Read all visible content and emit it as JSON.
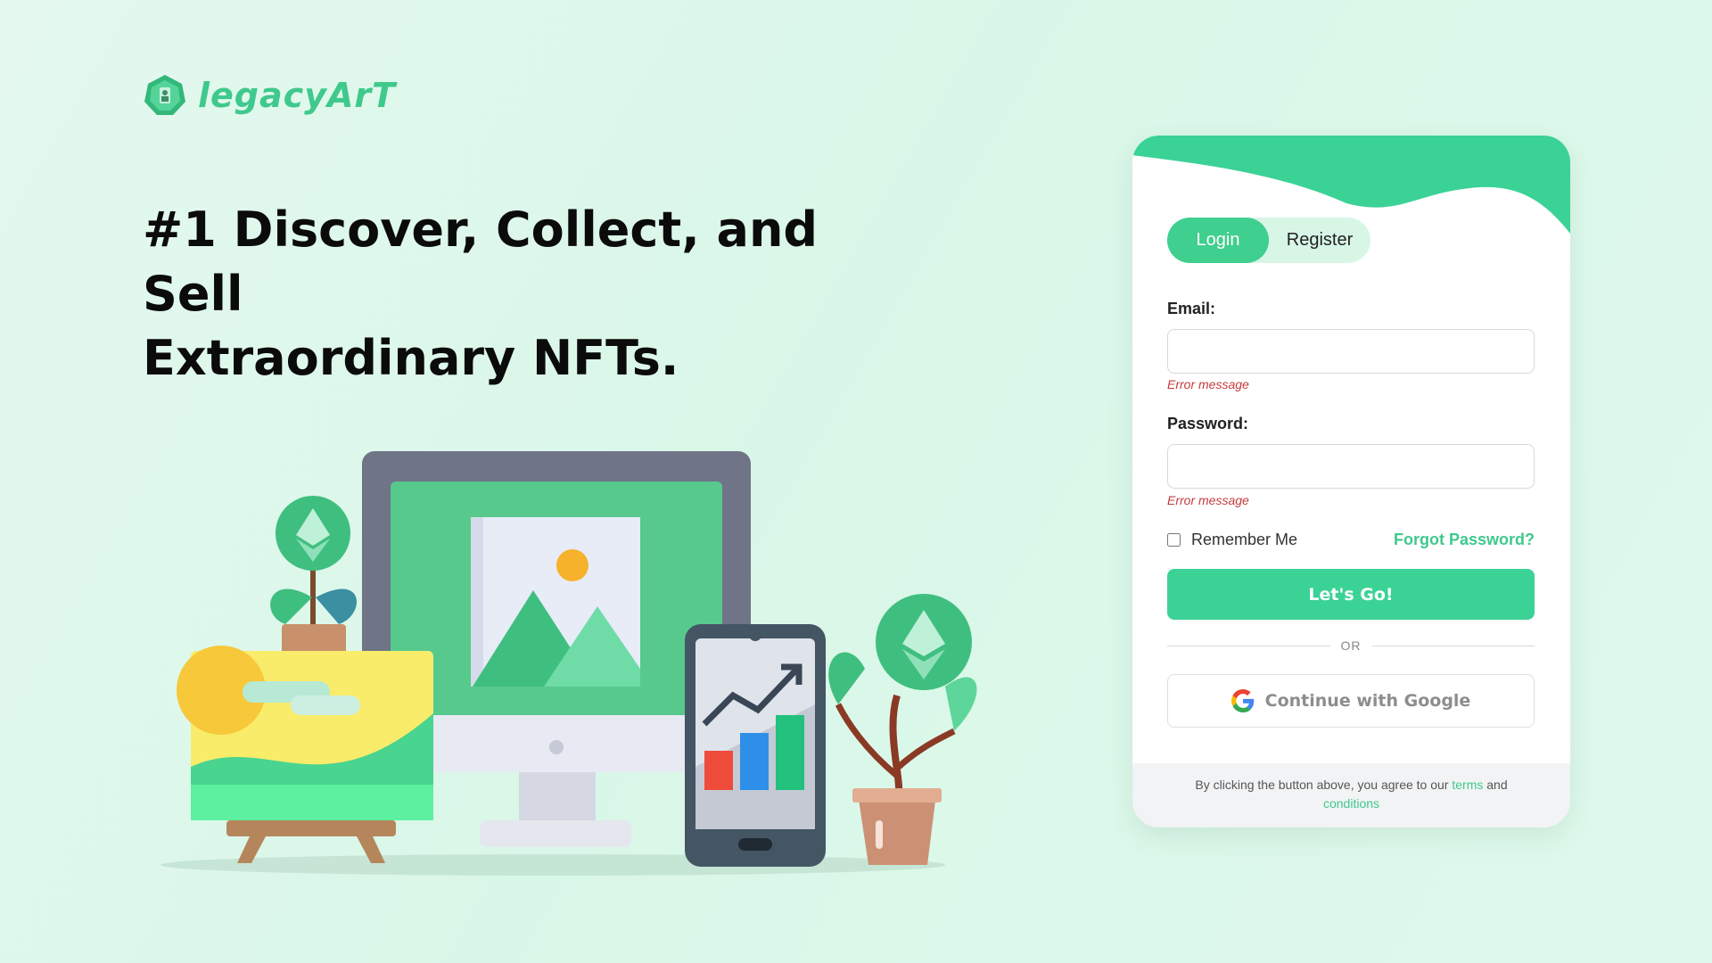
{
  "brand": {
    "name": "legacyArT",
    "accent": "#3fc98c"
  },
  "hero": {
    "line1": "#1 Discover, Collect, and Sell",
    "line2": "Extraordinary NFTs."
  },
  "auth": {
    "tabs": {
      "login": "Login",
      "register": "Register"
    },
    "email": {
      "label": "Email:",
      "value": "",
      "placeholder": "",
      "error": "Error message"
    },
    "password": {
      "label": "Password:",
      "value": "",
      "placeholder": "",
      "error": "Error message"
    },
    "remember_label": "Remember Me",
    "forgot_label": "Forgot Password?",
    "submit_label": "Let's Go!",
    "divider_label": "OR",
    "google_label": "Continue with Google",
    "footer": {
      "prefix": "By clicking the button above, you agree to our",
      "terms": "terms",
      "and": "and",
      "conditions": "conditions"
    }
  },
  "icons": [
    "logo-icon",
    "google-icon",
    "ethereum-icon",
    "image-icon",
    "chart-icon"
  ],
  "colors": {
    "primary": "#3bd296",
    "tab_bg": "#d7f6e6",
    "error": "#c43c3c"
  }
}
